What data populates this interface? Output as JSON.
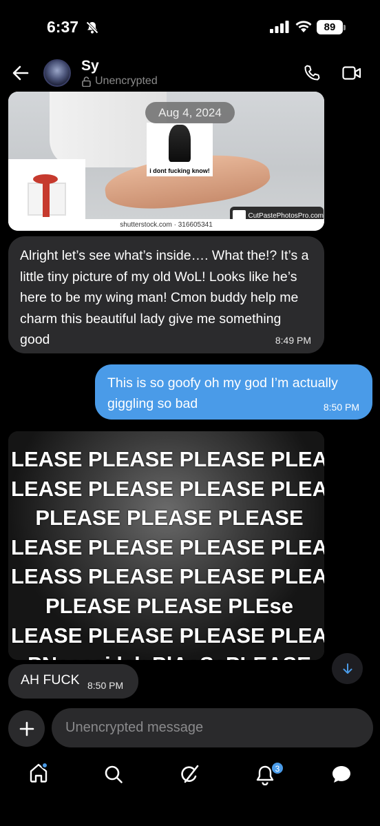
{
  "status_bar": {
    "time": "6:37",
    "battery": "89"
  },
  "header": {
    "contact_name": "Sy",
    "encryption": "Unencrypted"
  },
  "messages": {
    "date_chip": "Aug 4, 2024",
    "image1": {
      "meme_caption": "i dont fucking know!",
      "credit": "shutterstock.com · 316605341",
      "watermark": "CutPastePhotosPro.com"
    },
    "msg1": {
      "text": "Alright let’s see what’s inside…. What the!? It’s a little tiny picture of my old WoL! Looks like he’s here to be my wing man! Cmon buddy help me charm this beautiful lady give me something good",
      "time": "8:49 PM"
    },
    "msg2": {
      "text": "This is so goofy oh my god I’m actually giggling so bad",
      "time": "8:50 PM"
    },
    "image2": {
      "lines": [
        "LEASE PLEASE PLEASE PLEA",
        "LEASE PLEASE PLEASE PLEA",
        "PLEASE PLEASE PLEASE",
        "LEASE PLEASE PLEASE PLEA",
        "LEASS PLEASE PLEASE PLEA",
        "PLEASE PLEASE PLEse",
        "LEASE PLEASE PLEASE PLEA",
        "PNeacsi lek PlAsSePLEASE"
      ]
    },
    "msg3": {
      "text": "AH FUCK",
      "time": "8:50 PM"
    }
  },
  "composer": {
    "placeholder": "Unencrypted message"
  },
  "nav": {
    "notifications_badge": "3"
  },
  "colors": {
    "accent": "#4a9be8",
    "incoming_bubble": "#2b2b2d",
    "background": "#000000"
  }
}
